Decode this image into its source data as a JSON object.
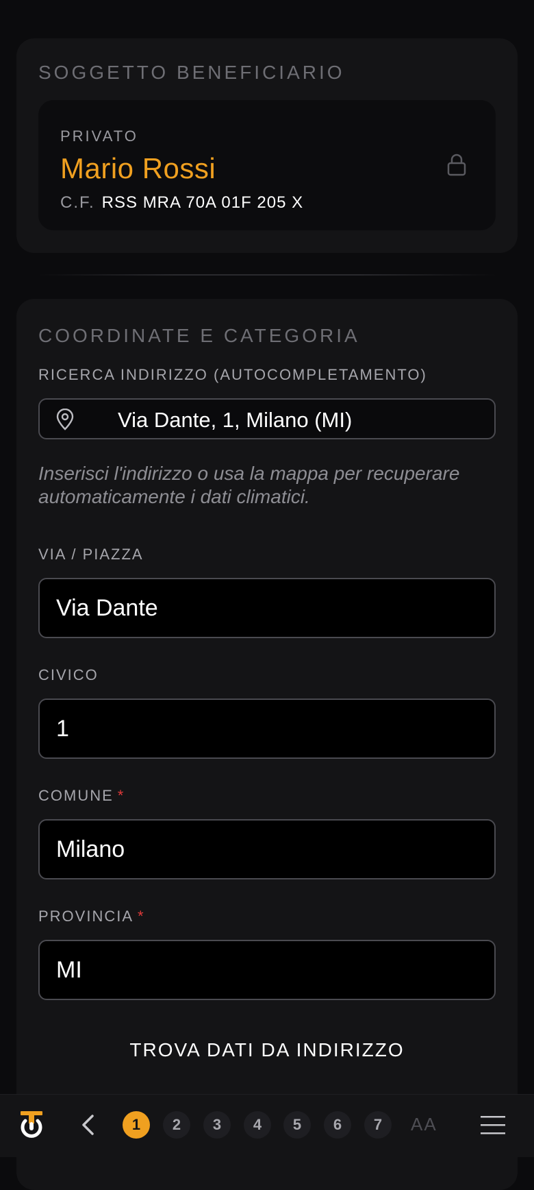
{
  "subject": {
    "title": "SOGGETTO BENEFICIARIO",
    "type": "PRIVATO",
    "name": "Mario Rossi",
    "cf_label": "C.F.",
    "cf_value": "RSS MRA 70A 01F 205 X",
    "lock_icon": "lock-icon"
  },
  "coords": {
    "title": "COORDINATE E CATEGORIA",
    "search_label": "RICERCA INDIRIZZO (AUTOCOMPLETAMENTO)",
    "search_value": "Via Dante, 1, Milano (MI)",
    "search_icon": "map-pin-icon",
    "hint": "Inserisci l'indirizzo o usa la mappa per recuperare automaticamente i dati climatici.",
    "street_label": "VIA / PIAZZA",
    "street_value": "Via Dante",
    "number_label": "CIVICO",
    "number_value": "1",
    "city_label": "COMUNE",
    "city_value": "Milano",
    "province_label": "PROVINCIA",
    "province_value": "MI",
    "required_mark": "*",
    "action_label": "TROVA DATI DA INDIRIZZO"
  },
  "nav": {
    "steps": [
      "1",
      "2",
      "3",
      "4",
      "5",
      "6",
      "7"
    ],
    "active_step": "1",
    "text_size_label": "AA",
    "accent_color": "#f0a020"
  }
}
